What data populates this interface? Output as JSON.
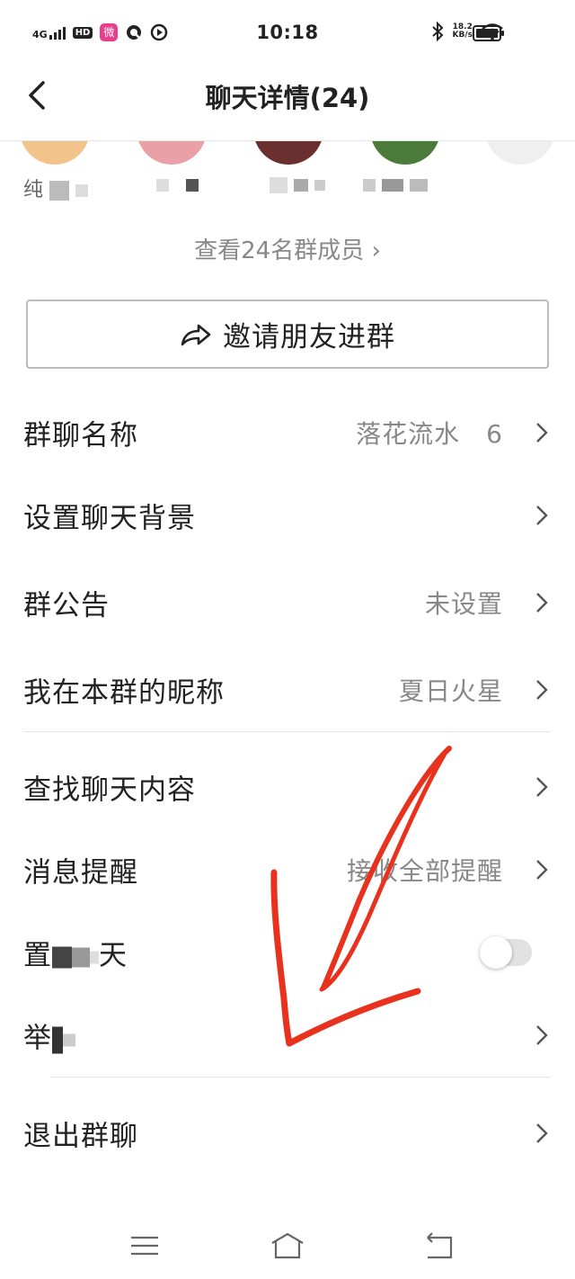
{
  "status_bar": {
    "network": "4G",
    "hd": "HD",
    "app_badge": "微",
    "time": "10:18",
    "net_speed_value": "18.2",
    "net_speed_unit": "KB/s"
  },
  "header": {
    "title": "聊天详情(24)"
  },
  "members": {
    "items": [
      {
        "name": "纯",
        "avatar_color": "#f2c38a"
      },
      {
        "name": "",
        "avatar_color": "#e9a0a6"
      },
      {
        "name": "",
        "avatar_color": "#7a3b3b"
      },
      {
        "name": "",
        "avatar_color": "#4b7a3a"
      },
      {
        "name": "",
        "avatar_color": "#eeeeee"
      }
    ],
    "view_all": "查看24名群成员 ›"
  },
  "invite": {
    "label": "邀请朋友进群"
  },
  "rows": {
    "group_name": {
      "label": "群聊名称",
      "value": "落花流水　6"
    },
    "background": {
      "label": "设置聊天背景"
    },
    "notice": {
      "label": "群公告",
      "value": "未设置"
    },
    "nickname": {
      "label": "我在本群的昵称",
      "value": "夏日火星"
    },
    "search": {
      "label": "查找聊天内容"
    },
    "notify": {
      "label": "消息提醒",
      "value": "接收全部提醒"
    },
    "pin": {
      "label_start": "置",
      "label_end": "天"
    },
    "report": {
      "label_start": "举"
    },
    "exit": {
      "label": "退出群聊"
    }
  },
  "colors": {
    "annotation": "#e8321e",
    "toggle_track": "#e2e2e2"
  },
  "icons": {
    "back": "back-arrow-icon",
    "share": "share-arrow-icon",
    "chevron": "chevron-right-icon",
    "nav": [
      "menu-icon",
      "home-icon",
      "back-icon"
    ]
  }
}
